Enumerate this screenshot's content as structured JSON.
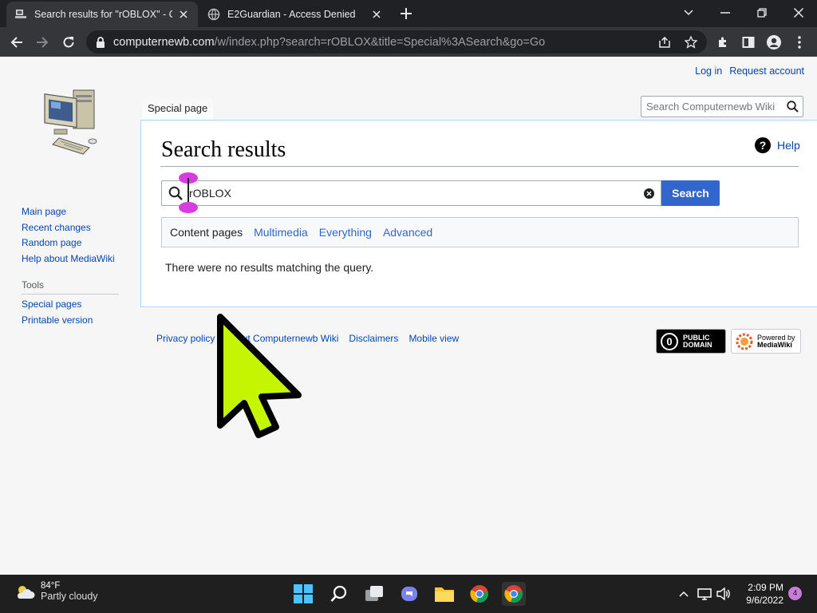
{
  "browser": {
    "tabs": [
      {
        "title": "Search results for \"rOBLOX\" - Cor",
        "active": true
      },
      {
        "title": "E2Guardian - Access Denied",
        "active": false
      }
    ],
    "url_host": "computernewb.com",
    "url_path": "/w/index.php?search=rOBLOX&title=Special%3ASearch&go=Go"
  },
  "wiki": {
    "personal": {
      "login": "Log in",
      "request": "Request account"
    },
    "sidebar": {
      "nav": [
        "Main page",
        "Recent changes",
        "Random page",
        "Help about MediaWiki"
      ],
      "tools_heading": "Tools",
      "tools": [
        "Special pages",
        "Printable version"
      ]
    },
    "tab_label": "Special page",
    "search_placeholder": "Search Computernewb Wiki",
    "heading": "Search results",
    "help": "Help",
    "query": "rOBLOX",
    "search_button": "Search",
    "profiles": [
      "Content pages",
      "Multimedia",
      "Everything",
      "Advanced"
    ],
    "no_results": "There were no results matching the query.",
    "footer_links": [
      "Privacy policy",
      "About Computernewb Wiki",
      "Disclaimers",
      "Mobile view"
    ],
    "badge_pd": {
      "line1": "PUBLIC",
      "line2": "DOMAIN"
    },
    "badge_mw": {
      "line1": "Powered by",
      "line2": "MediaWiki"
    }
  },
  "taskbar": {
    "temp": "84°F",
    "weather": "Partly cloudy",
    "time": "2:09 PM",
    "date": "9/6/2022",
    "notifications": "4"
  },
  "colors": {
    "link": "#0645ad",
    "search_button": "#3366cc",
    "cursor_fill": "#c6f500"
  }
}
